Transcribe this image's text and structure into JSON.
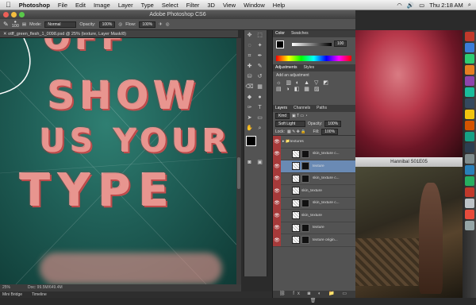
{
  "menubar": {
    "app_name": "Photoshop",
    "items": [
      "File",
      "Edit",
      "Image",
      "Layer",
      "Type",
      "Select",
      "Filter",
      "3D",
      "View",
      "Window",
      "Help"
    ],
    "clock": "Thu 2:18 AM"
  },
  "window": {
    "title": "Adobe Photoshop CS6"
  },
  "options_bar": {
    "brush_size": "100",
    "mode_label": "Mode:",
    "mode_value": "Normal",
    "opacity_label": "Opacity:",
    "opacity_value": "100%",
    "flow_label": "Flow:",
    "flow_value": "100%"
  },
  "document": {
    "tab_title": "otff_green_flesh_1_0098.psd @ 25% (texture, Layer Mask/8)",
    "canvas_words": [
      "OFF",
      "SHOW",
      "US YOUR",
      "TYPE"
    ],
    "zoom": "25%",
    "doc_size": "Doc: 99.5M/649.4M"
  },
  "bottom_tabs": [
    "Mini Bridge",
    "Timeline"
  ],
  "panels": {
    "color_tabs": [
      "Color",
      "Swatches"
    ],
    "color_value": "100",
    "adjust_tabs": [
      "Adjustments",
      "Styles"
    ],
    "adjust_heading": "Add an adjustment",
    "layers_tabs": [
      "Layers",
      "Channels",
      "Paths"
    ],
    "kind_label": "Kind",
    "blend_mode": "Soft Light",
    "opacity_label": "Opacity:",
    "opacity_value": "100%",
    "lock_label": "Lock:",
    "fill_label": "Fill:",
    "fill_value": "100%",
    "layers": [
      {
        "name": "textures",
        "type": "group"
      },
      {
        "name": "skin_texture c...",
        "type": "layer"
      },
      {
        "name": "texture",
        "type": "layer",
        "selected": true
      },
      {
        "name": "skin_texture c...",
        "type": "layer"
      },
      {
        "name": "skin_texture",
        "type": "layer"
      },
      {
        "name": "skin_texture c...",
        "type": "layer"
      },
      {
        "name": "skin_texture",
        "type": "layer"
      },
      {
        "name": "texture",
        "type": "layer"
      },
      {
        "name": "texture origin...",
        "type": "layer"
      }
    ]
  },
  "right_window": {
    "title": "Hannibal S01E05"
  },
  "colors": {
    "layer_eye": "#a63a3a",
    "canvas_bg": "#1f5e56",
    "selected_layer": "#6a8ab4"
  }
}
